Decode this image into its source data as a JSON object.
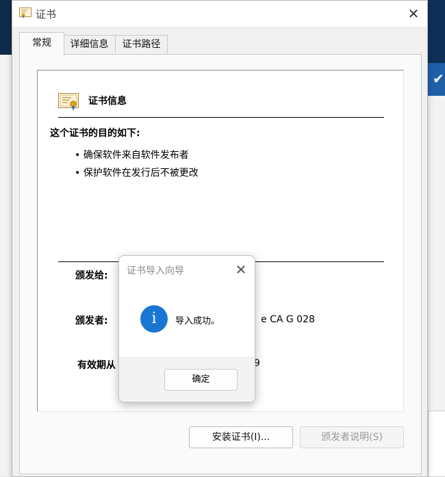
{
  "window": {
    "title": "证书",
    "close_glyph": "✕"
  },
  "tabs": [
    {
      "label": "常规"
    },
    {
      "label": "详细信息"
    },
    {
      "label": "证书路径"
    }
  ],
  "general": {
    "heading": "证书信息",
    "purpose_title": "这个证书的目的如下:",
    "bullets": [
      "确保软件来自软件发布者",
      "保护软件在发行后不被更改"
    ],
    "issued_to_label": "颁发给:",
    "issued_by_label": "颁发者:",
    "issued_by_value_partial": "e CA G 028",
    "valid_from_label": "有效期从",
    "valid_value_partial": "9"
  },
  "buttons": {
    "install": "安装证书(I)...",
    "issuer_statement": "颁发者说明(S)"
  },
  "dialog": {
    "title": "证书导入向导",
    "close_glyph": "✕",
    "message": "导入成功。",
    "ok": "确定",
    "icon_glyph": "i"
  },
  "icons": {
    "app": "certificate-icon",
    "info": "info-icon",
    "check": "checkmark-icon"
  },
  "colors": {
    "accent_blue": "#1976d2",
    "window_bg": "#f0f0f0"
  }
}
